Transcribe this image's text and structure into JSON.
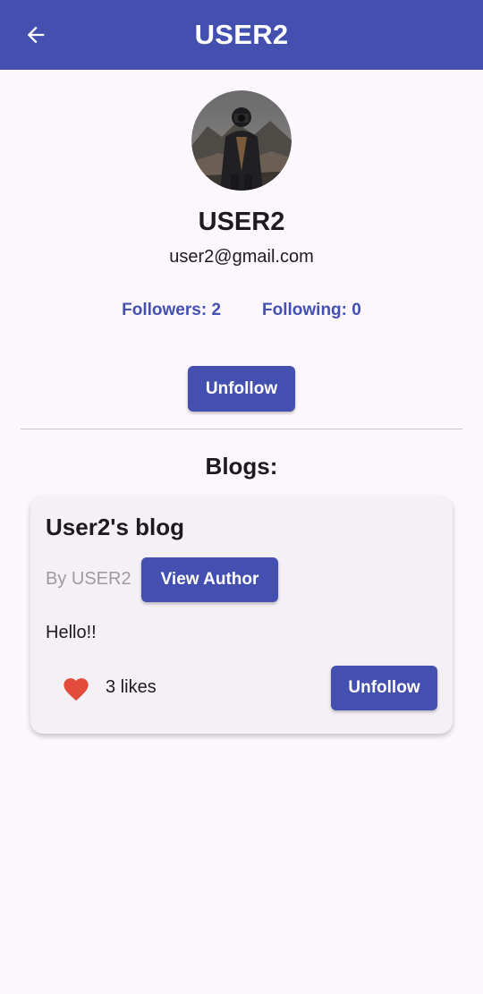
{
  "appbar": {
    "title": "USER2",
    "back_icon": "arrow-left-icon"
  },
  "profile": {
    "avatar_icon": "profile-photo",
    "name": "USER2",
    "email": "user2@gmail.com",
    "followers_text": "Followers: 2",
    "following_text": "Following: 0",
    "unfollow_label": "Unfollow"
  },
  "blogs": {
    "heading": "Blogs:",
    "items": [
      {
        "title": "User2's blog",
        "by_text": "By USER2",
        "view_author_label": "View Author",
        "body": "Hello!!",
        "likes_text": "3 likes",
        "like_icon": "heart-icon",
        "unfollow_label": "Unfollow"
      }
    ]
  },
  "colors": {
    "primary": "#4450b0",
    "background": "#fcf7fc",
    "card": "#f3f0f6",
    "heart": "#e34c3c",
    "muted_text": "#9e9aa2"
  }
}
